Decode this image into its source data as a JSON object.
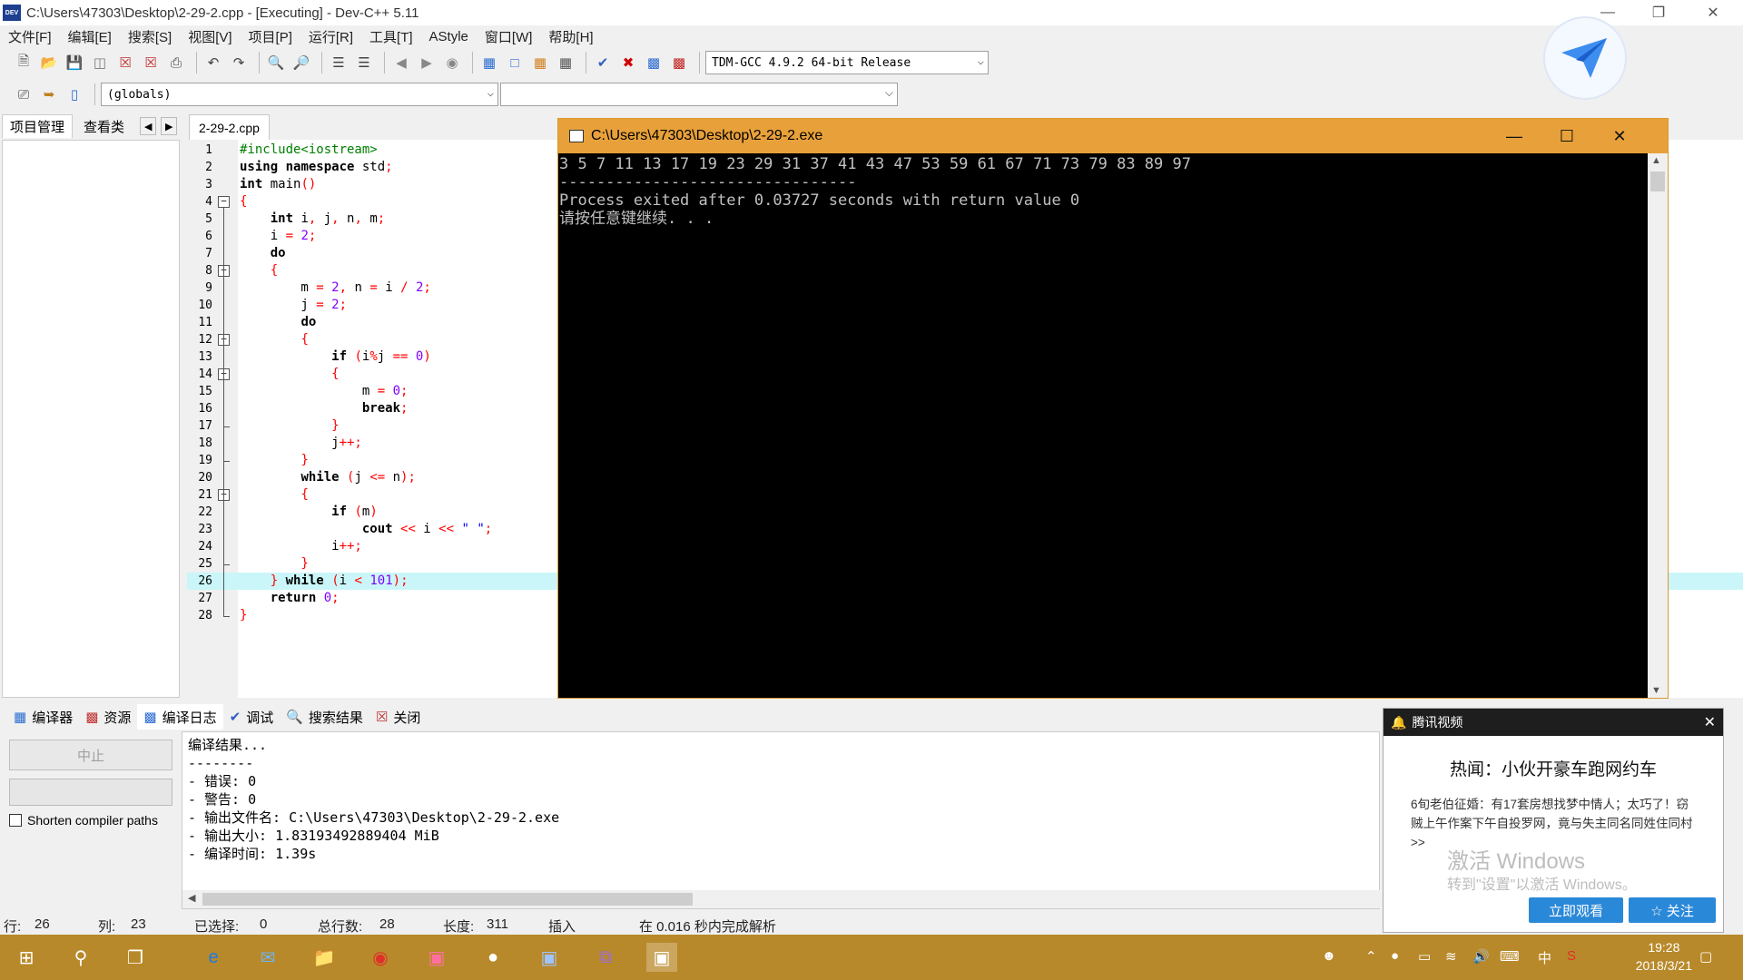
{
  "window": {
    "title": "C:\\Users\\47303\\Desktop\\2-29-2.cpp - [Executing] - Dev-C++ 5.11",
    "icon_text": "DEV"
  },
  "menu": [
    "文件[F]",
    "编辑[E]",
    "搜索[S]",
    "视图[V]",
    "项目[P]",
    "运行[R]",
    "工具[T]",
    "AStyle",
    "窗口[W]",
    "帮助[H]"
  ],
  "toolbar": {
    "compiler_select": "TDM-GCC 4.9.2 64-bit Release",
    "scope_select": "(globals)",
    "symbol_select": ""
  },
  "left_panel": {
    "tabs": [
      "项目管理",
      "查看类"
    ]
  },
  "editor": {
    "tab": "2-29-2.cpp",
    "current_line": 26,
    "lines": [
      "#include<iostream>",
      "using namespace std;",
      "int main()",
      "{",
      "    int i, j, n, m;",
      "    i = 2;",
      "    do",
      "    {",
      "        m = 2, n = i / 2;",
      "        j = 2;",
      "        do",
      "        {",
      "            if (i%j == 0)",
      "            {",
      "                m = 0;",
      "                break;",
      "            }",
      "            j++;",
      "        }",
      "        while (j <= n);",
      "        {",
      "            if (m)",
      "                cout << i << \" \";",
      "            i++;",
      "        }",
      "    } while (i < 101);",
      "    return 0;",
      "}"
    ]
  },
  "console": {
    "title": "C:\\Users\\47303\\Desktop\\2-29-2.exe",
    "lines": [
      "3 5 7 11 13 17 19 23 29 31 37 41 43 47 53 59 61 67 71 73 79 83 89 97",
      "--------------------------------",
      "Process exited after 0.03727 seconds with return value 0",
      "请按任意键继续. . ."
    ]
  },
  "bottom_panel": {
    "tabs": [
      {
        "icon": "grid-icon",
        "label": "编译器"
      },
      {
        "icon": "resource-icon",
        "label": "资源"
      },
      {
        "icon": "bar-chart-icon",
        "label": "编译日志"
      },
      {
        "icon": "check-icon",
        "label": "调试"
      },
      {
        "icon": "search-icon",
        "label": "搜索结果"
      },
      {
        "icon": "close-red-icon",
        "label": "关闭"
      }
    ],
    "stop_button": "中止",
    "shorten_paths_label": "Shorten compiler paths",
    "log": [
      "编译结果...",
      "--------",
      "- 错误: 0",
      "- 警告: 0",
      "- 输出文件名: C:\\Users\\47303\\Desktop\\2-29-2.exe",
      "- 输出大小: 1.83193492889404 MiB",
      "- 编译时间: 1.39s"
    ]
  },
  "statusbar": {
    "row_label": "行:",
    "row": "26",
    "col_label": "列:",
    "col": "23",
    "sel_label": "已选择:",
    "sel": "0",
    "total_label": "总行数:",
    "total": "28",
    "len_label": "长度:",
    "len": "311",
    "mode": "插入",
    "parse": "在 0.016 秒内完成解析"
  },
  "popup": {
    "app": "腾讯视频",
    "headline": "热闻：小伙开豪车跑网约车",
    "text": "6旬老伯征婚：有17套房想找梦中情人；太巧了！窃贼上午作案下午自投罗网，竟与失主同名同姓住同村>>",
    "watermark_title": "激活 Windows",
    "watermark_sub": "转到\"设置\"以激活 Windows。",
    "watch_button": "立即观看",
    "follow_button": "☆ 关注"
  },
  "taskbar": {
    "time": "19:28",
    "date": "2018/3/21",
    "ime": "中"
  },
  "colors": {
    "accent": "#e8a13a",
    "taskbar": "#b8892a",
    "current_line": "#cbf6f9"
  }
}
